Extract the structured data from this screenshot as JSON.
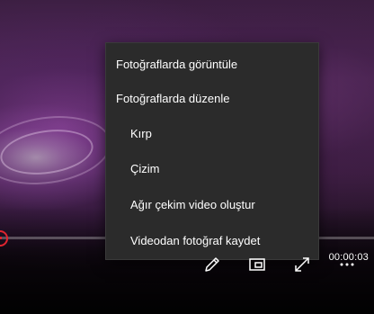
{
  "menu": {
    "items": [
      {
        "label": "Fotoğraflarda görüntüle"
      },
      {
        "label": "Fotoğraflarda düzenle"
      },
      {
        "label": "Kırp"
      },
      {
        "label": "Çizim"
      },
      {
        "label": "Ağır çekim video oluştur"
      },
      {
        "label": "Videodan fotoğraf kaydet"
      }
    ]
  },
  "playback": {
    "time": "00:00:03",
    "progress": 0.0
  },
  "toolbar": {
    "icons": [
      "pencil-icon",
      "picture-in-picture-icon",
      "fullscreen-icon",
      "more-icon"
    ]
  },
  "colors": {
    "accent": "#e0242f",
    "menu_bg": "#2b2b2b",
    "text": "#ffffff"
  }
}
